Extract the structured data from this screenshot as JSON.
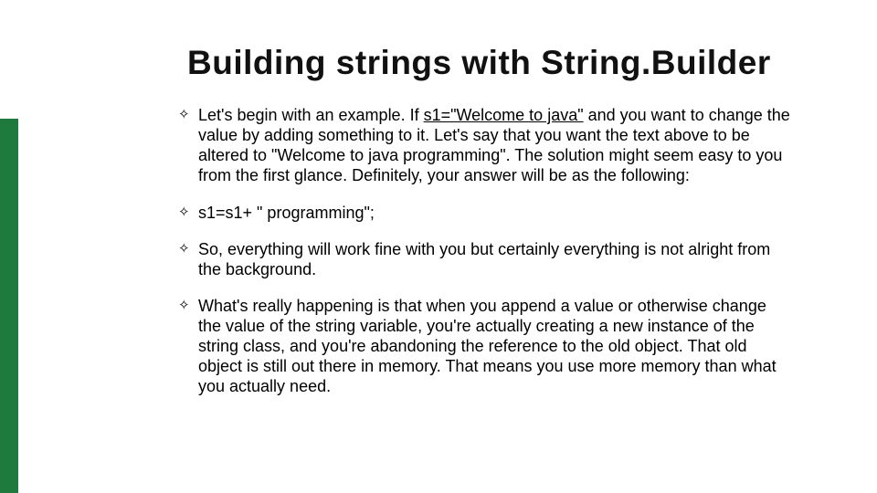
{
  "title": "Building strings with String.Builder",
  "bullets": [
    {
      "pre": "Let's begin with an example. If ",
      "u": "s1=\"Welcome to java\"",
      "post": " and you want to change the value by adding something to it. Let's say that you want the text above to be altered to \"Welcome to java programming\". The solution might seem easy to you from the first glance. Definitely, your answer will be as the following:"
    },
    {
      "text": "s1=s1+ \" programming\";"
    },
    {
      "text": "So, everything will work fine with you but certainly everything is not alright from the background."
    },
    {
      "text": "What's really happening is that when you append a value or otherwise change the value of the string variable, you're actually creating a new instance of the string class, and you're abandoning the reference to the old object. That old object is still out there in memory. That means you use more memory than what you actually need."
    }
  ],
  "bullet_glyph": "✧"
}
